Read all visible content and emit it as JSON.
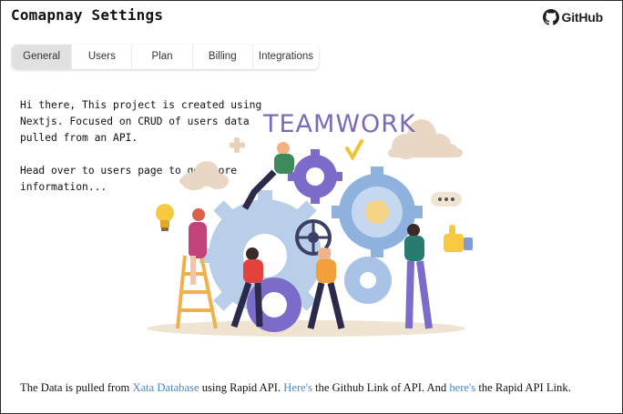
{
  "header": {
    "app_title": "Comapnay Settings",
    "github_label": "GitHub"
  },
  "tabs": [
    {
      "label": "General",
      "active": true
    },
    {
      "label": "Users",
      "active": false
    },
    {
      "label": "Plan",
      "active": false
    },
    {
      "label": "Billing",
      "active": false
    },
    {
      "label": "Integrations",
      "active": false
    }
  ],
  "main": {
    "intro_paragraph_1": "Hi there, This project is created using Nextjs. Focused on CRUD of users data pulled from an API.",
    "intro_paragraph_2": "Head over to users page to get more information...",
    "illustration": {
      "icon": "teamwork-illustration",
      "caption": "TEAMWORK"
    }
  },
  "footer": {
    "text_1": "The Data is pulled from ",
    "link_1": "Xata Database",
    "text_2": " using Rapid API. ",
    "link_2": "Here's",
    "text_3": " the Github Link of API. And ",
    "link_3": "here's",
    "text_4": " the Rapid API Link."
  },
  "colors": {
    "link": "#4b86c4",
    "active_tab": "#e1e1e1",
    "teamwork_text": "#7a6ab8",
    "gear_blue": "#b9cfe9",
    "gear_purple": "#7d6bc9",
    "cloud": "#e8d7c2"
  }
}
